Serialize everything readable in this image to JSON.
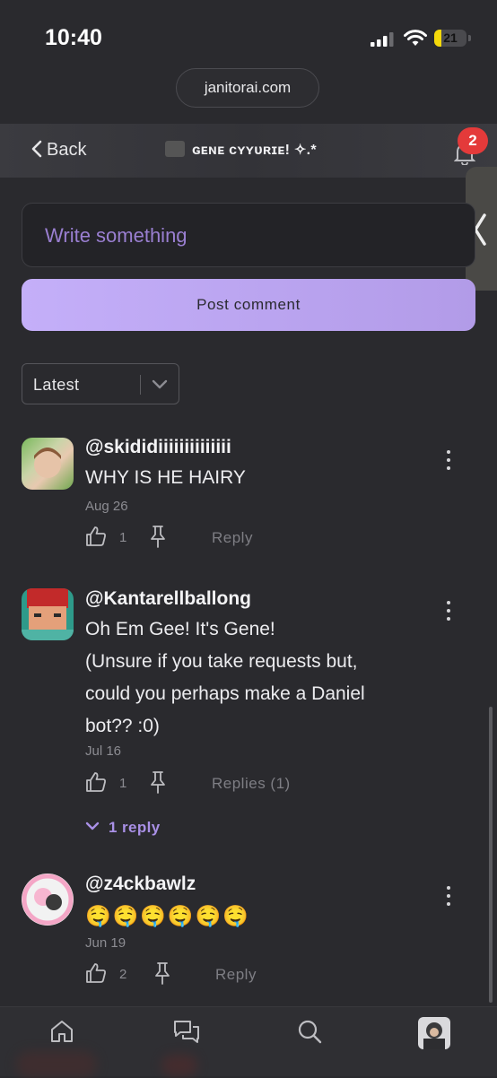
{
  "status_bar": {
    "time": "10:40",
    "battery": "21"
  },
  "browser": {
    "url": "janitorai.com"
  },
  "header": {
    "back_label": "Back",
    "title": "ɢᴇɴᴇ ᴄʏʏᴜʀɪᴇ! ✧.*",
    "notification_count": "2"
  },
  "composer": {
    "placeholder": "Write something",
    "post_label": "Post comment"
  },
  "sort": {
    "selected": "Latest"
  },
  "comments": [
    {
      "username": "@skididiiiiiiiiiiiiii",
      "lines": [
        "WHY IS HE HAIRY"
      ],
      "date": "Aug 26",
      "likes": "1",
      "reply_label": "Reply"
    },
    {
      "username": "@Kantarellballong",
      "lines": [
        "Oh Em Gee! It's Gene!",
        "(Unsure if you take requests but,",
        "could you perhaps make a Daniel",
        "bot?? :0)"
      ],
      "date": "Jul 16",
      "likes": "1",
      "reply_label": "Replies (1)",
      "show_replies": "1 reply"
    },
    {
      "username": "@z4ckbawlz",
      "lines": [
        "🤤🤤🤤🤤🤤🤤"
      ],
      "date": "Jun 19",
      "likes": "2",
      "reply_label": "Reply"
    }
  ],
  "colors": {
    "accent": "#b9a3f2",
    "badge": "#e43a3a",
    "background": "#2a2a2e"
  },
  "nav": {
    "items": [
      "home-icon",
      "chat-icon",
      "search-icon",
      "profile-avatar"
    ]
  }
}
